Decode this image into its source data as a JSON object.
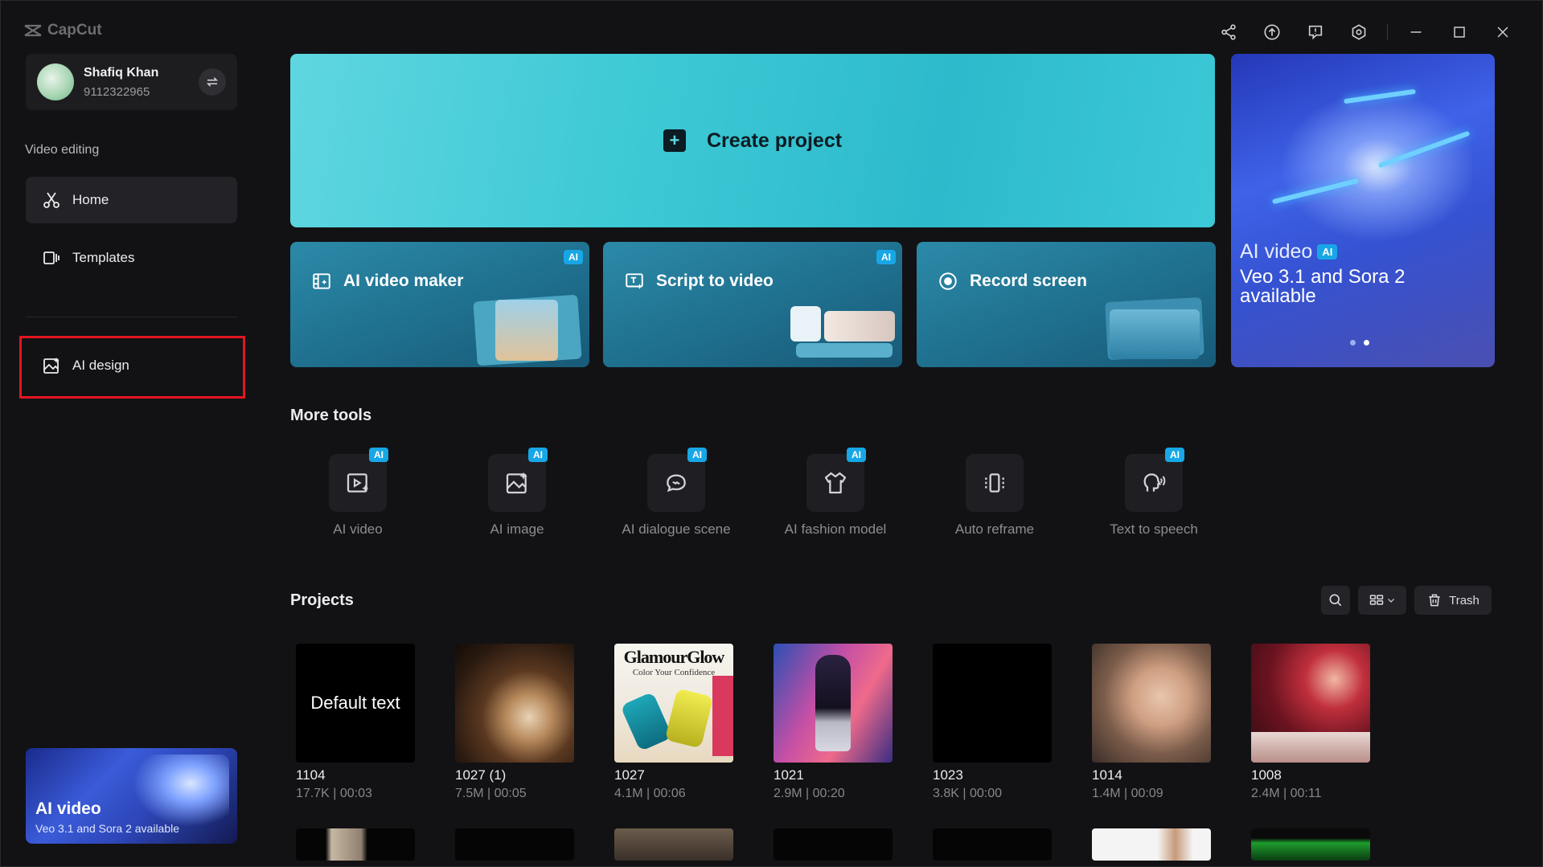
{
  "app": {
    "brand": "CapCut"
  },
  "user": {
    "name": "Shafiq Khan",
    "phone": "9112322965"
  },
  "sidebar": {
    "section_label": "Video editing",
    "items": [
      {
        "label": "Home",
        "icon": "scissors-icon",
        "active": true
      },
      {
        "label": "Templates",
        "icon": "templates-icon",
        "active": false
      },
      {
        "label": "AI design",
        "icon": "ai-design-icon",
        "active": false,
        "highlighted": true
      }
    ],
    "promo": {
      "title": "AI video",
      "subtitle": "Veo 3.1 and Sora 2 available"
    }
  },
  "hero": {
    "create_label": "Create project",
    "tools": [
      {
        "label": "AI video maker",
        "badge": "AI",
        "icon": "ai-video-maker-icon"
      },
      {
        "label": "Script to video",
        "badge": "AI",
        "icon": "script-to-video-icon"
      },
      {
        "label": "Record screen",
        "badge": "",
        "icon": "record-icon"
      }
    ],
    "banner": {
      "title": "AI video",
      "badge": "AI",
      "subtitle": "Veo 3.1 and Sora 2 available",
      "slide": 2,
      "slides": 2
    }
  },
  "more_tools": {
    "heading": "More tools",
    "items": [
      {
        "label": "AI video",
        "badge": "AI",
        "icon": "ai-video-icon"
      },
      {
        "label": "AI image",
        "badge": "AI",
        "icon": "ai-image-icon"
      },
      {
        "label": "AI dialogue scene",
        "badge": "AI",
        "icon": "ai-dialogue-icon"
      },
      {
        "label": "AI fashion model",
        "badge": "AI",
        "icon": "ai-fashion-icon"
      },
      {
        "label": "Auto reframe",
        "badge": "",
        "icon": "auto-reframe-icon"
      },
      {
        "label": "Text to speech",
        "badge": "AI",
        "icon": "text-to-speech-icon"
      }
    ]
  },
  "projects": {
    "heading": "Projects",
    "trash_label": "Trash",
    "items": [
      {
        "name": "1104",
        "meta": "17.7K | 00:03",
        "thumb_text": "Default text"
      },
      {
        "name": "1027 (1)",
        "meta": "7.5M | 00:05",
        "thumb_text": ""
      },
      {
        "name": "1027",
        "meta": "4.1M | 00:06",
        "thumb_text": "GlamourGlow",
        "thumb_sub": "Color Your Confidence"
      },
      {
        "name": "1021",
        "meta": "2.9M | 00:20",
        "thumb_text": ""
      },
      {
        "name": "1023",
        "meta": "3.8K | 00:00",
        "thumb_text": ""
      },
      {
        "name": "1014",
        "meta": "1.4M | 00:09",
        "thumb_text": ""
      },
      {
        "name": "1008",
        "meta": "2.4M | 00:11",
        "thumb_text": ""
      }
    ]
  },
  "colors": {
    "accent_cyan": "#3fcad6",
    "ai_badge": "#18a7e6",
    "highlight": "#e4151f"
  }
}
